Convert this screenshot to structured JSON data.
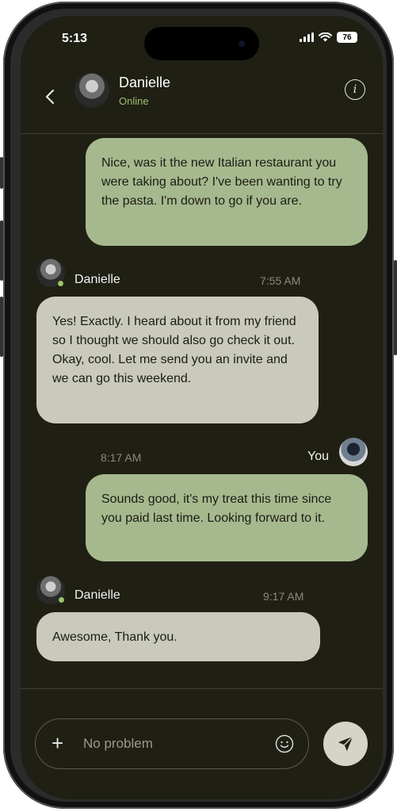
{
  "status_bar": {
    "time": "5:13",
    "battery": "76"
  },
  "header": {
    "contact_name": "Danielle",
    "contact_status": "Online"
  },
  "messages": [
    {
      "sender": "You",
      "text": "Nice, was it the new Italian restaurant you were taking about? I've been wanting to try the pasta. I'm down to go if you are."
    },
    {
      "sender": "Danielle",
      "time": "7:55 AM",
      "text": "Yes! Exactly. I heard about it from my friend so I thought we should also go check it out. Okay, cool. Let me send you an invite and we can go this weekend."
    },
    {
      "sender": "You",
      "time": "8:17 AM",
      "text": "Sounds good, it's my treat this time since you paid last time. Looking forward to it."
    },
    {
      "sender": "Danielle",
      "time": "9:17 AM",
      "text": "Awesome, Thank you."
    }
  ],
  "composer": {
    "placeholder": "No problem"
  },
  "colors": {
    "background": "#1f1f14",
    "outgoing_bubble": "#a6b98e",
    "incoming_bubble": "#c9cabb",
    "online": "#9ec36a"
  },
  "icons": [
    "back-chevron-icon",
    "info-icon",
    "plus-icon",
    "smiley-icon",
    "send-icon"
  ]
}
